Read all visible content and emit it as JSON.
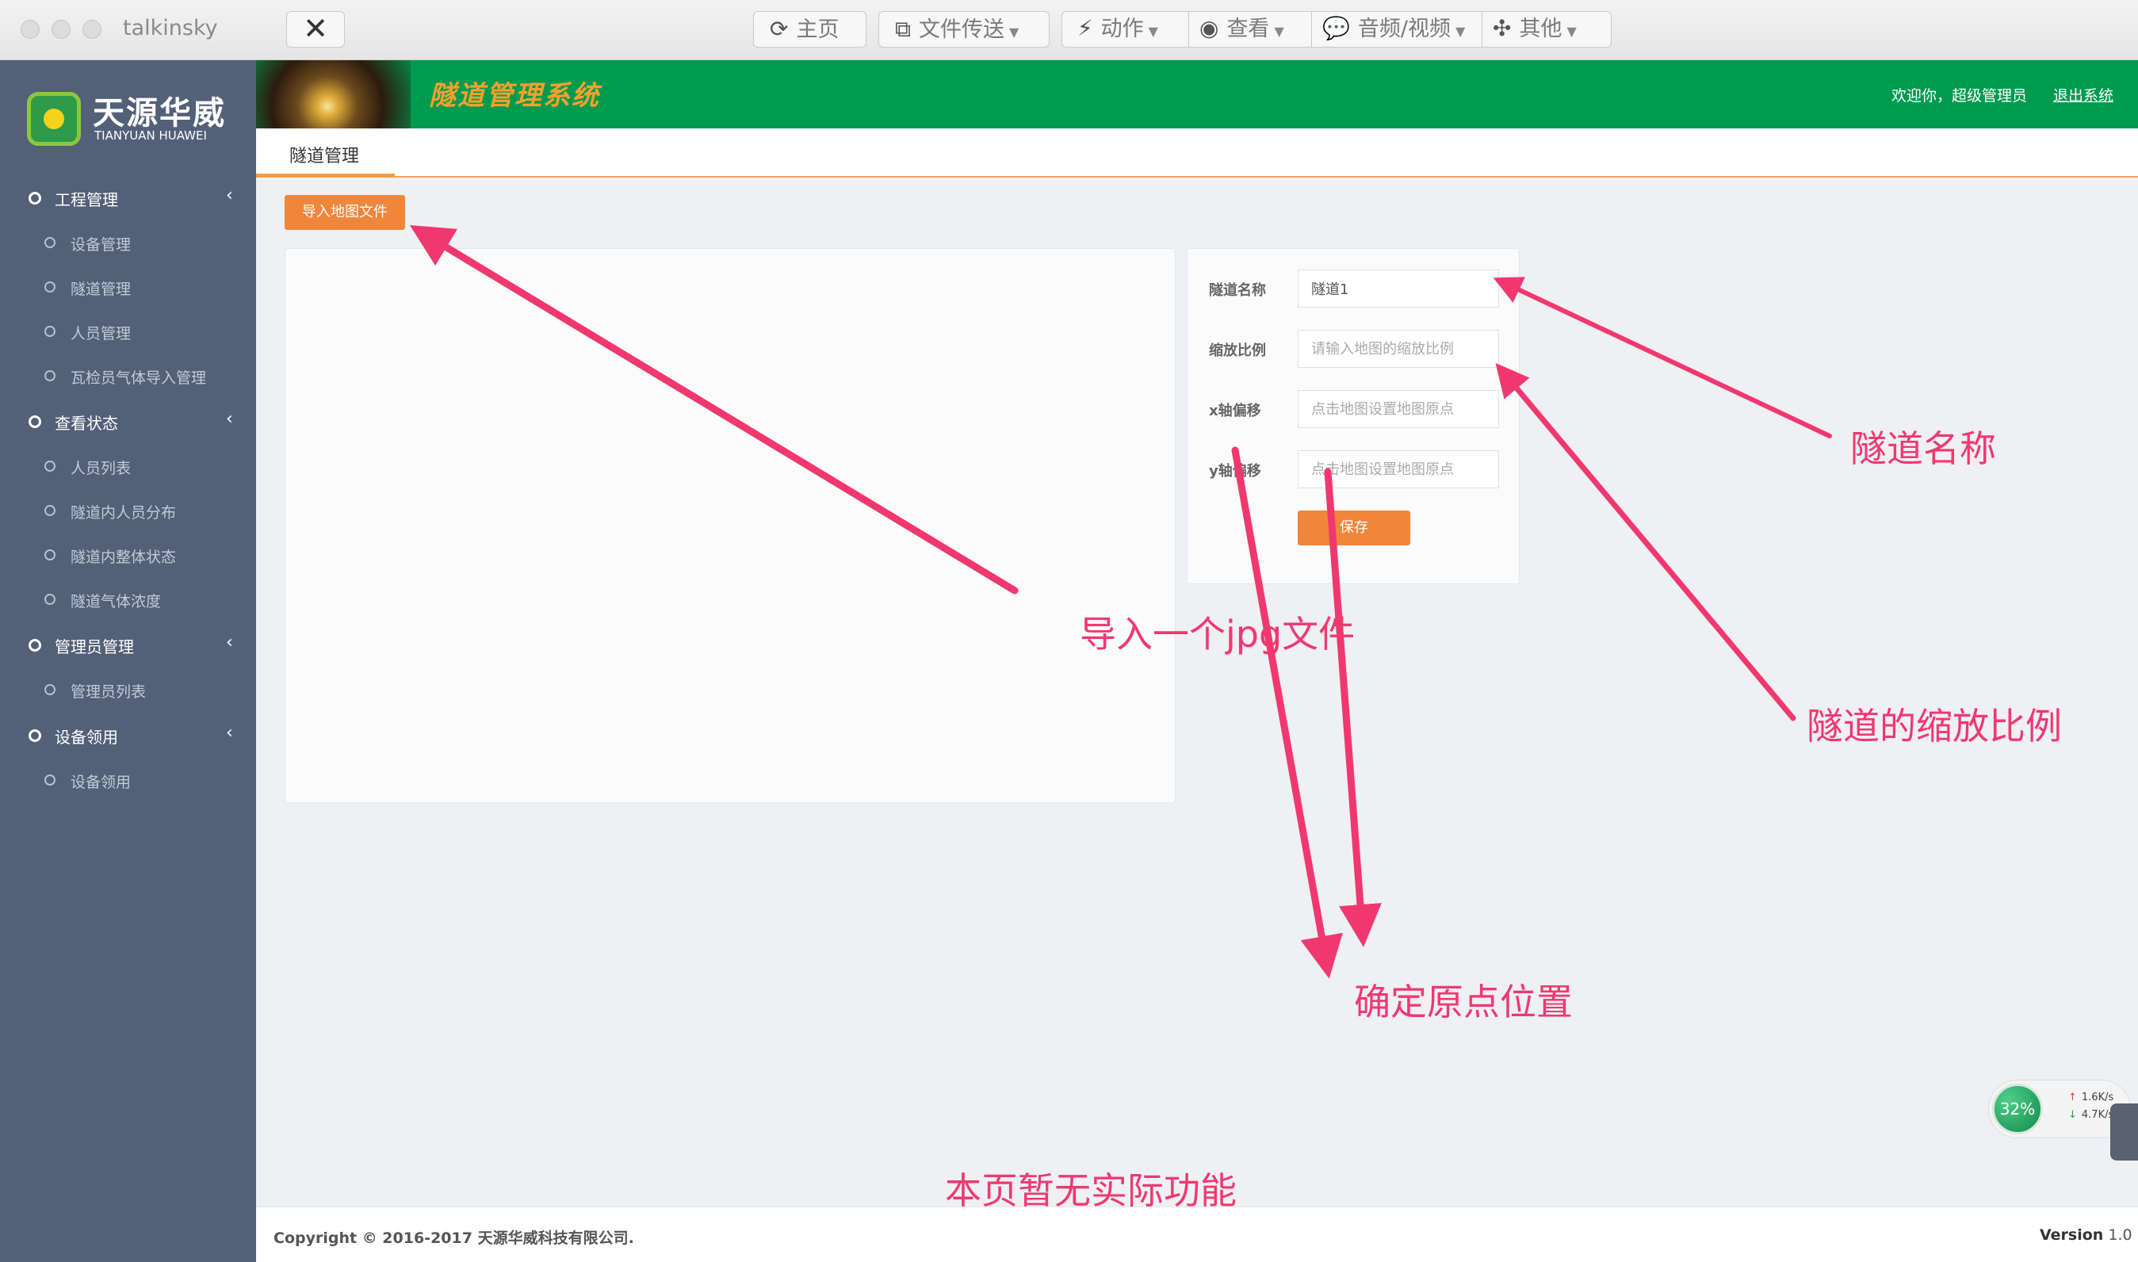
{
  "window": {
    "app_name": "talkinsky",
    "close_icon": "✕"
  },
  "toolbar": {
    "home": "主页",
    "file_transfer": "文件传送",
    "action": "动作",
    "view": "查看",
    "audio_video": "音频/视频",
    "other": "其他"
  },
  "brand": {
    "name_cn": "天源华威",
    "name_en": "TIANYUAN HUAWEI",
    "system_title": "隧道管理系统"
  },
  "header": {
    "welcome": "欢迎你，超级管理员",
    "logout": "退出系统"
  },
  "sidebar": {
    "groups": [
      {
        "label": "工程管理",
        "items": [
          "设备管理",
          "隧道管理",
          "人员管理",
          "瓦检员气体导入管理"
        ]
      },
      {
        "label": "查看状态",
        "items": [
          "人员列表",
          "隧道内人员分布",
          "隧道内整体状态",
          "隧道气体浓度"
        ]
      },
      {
        "label": "管理员管理",
        "items": [
          "管理员列表"
        ]
      },
      {
        "label": "设备领用",
        "items": [
          "设备领用"
        ]
      }
    ]
  },
  "tabs": {
    "active": "隧道管理"
  },
  "main": {
    "import_button": "导入地图文件",
    "form": {
      "name_label": "隧道名称",
      "name_value": "隧道1",
      "scale_label": "缩放比例",
      "scale_placeholder": "请输入地图的缩放比例",
      "x_label": "x轴偏移",
      "x_placeholder": "点击地图设置地图原点",
      "y_label": "y轴偏移",
      "y_placeholder": "点击地图设置地图原点",
      "save": "保存"
    }
  },
  "annotations": {
    "import_jpg": "导入一个jpg文件",
    "tunnel_name": "隧道名称",
    "tunnel_scale": "隧道的缩放比例",
    "origin": "确定原点位置",
    "no_function": "本页暂无实际功能",
    "color": "#f0386f"
  },
  "net_widget": {
    "percent": "32%",
    "up": "1.6K/s",
    "down": "4.7K/s"
  },
  "footer": {
    "copyright": "Copyright © 2016-2017 天源华威科技有限公司.",
    "version_label": "Version",
    "version_number": "1.0"
  }
}
